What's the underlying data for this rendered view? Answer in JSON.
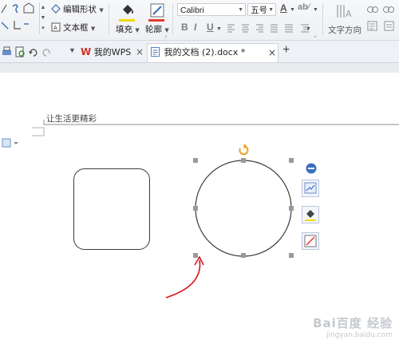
{
  "ribbon": {
    "edit_shape_label": "编辑形状",
    "textbox_label": "文本框",
    "fill_label": "填充",
    "outline_label": "轮廓",
    "font_name": "Calibri",
    "font_size": "五号",
    "text_direction_label": "文字方向",
    "fill_color": "#f5d800",
    "outline_color": "#e23b2e"
  },
  "tabs": {
    "wps_tab_label": "我的WPS",
    "doc_tab_label": "我的文档 (2).docx *",
    "close_glyph": "×",
    "new_tab_glyph": "+"
  },
  "document": {
    "header_text": "让生活更精彩"
  },
  "shape_tools": {
    "accent_color": "#3a6fc2"
  },
  "watermark": {
    "main": "Bai百度 经验",
    "url": "jingyan.baidu.com"
  }
}
